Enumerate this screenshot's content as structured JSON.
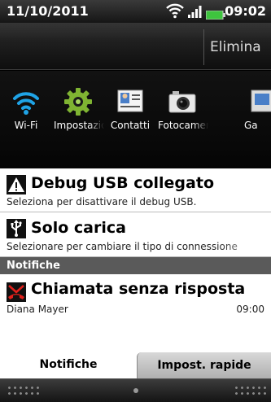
{
  "statusbar": {
    "date": "11/10/2011",
    "time": "09:02",
    "icons": [
      "wifi-signal-icon",
      "cell-signal-icon",
      "battery-icon"
    ]
  },
  "actionbar": {
    "clear_label": "Elimina"
  },
  "quick_toggles": [
    {
      "label": "Wi-Fi",
      "icon": "wifi-icon"
    },
    {
      "label": "Impostazioni",
      "icon": "settings-gear-icon"
    },
    {
      "label": "Contatti",
      "icon": "contacts-icon"
    },
    {
      "label": "Fotocamera",
      "icon": "camera-icon"
    },
    {
      "label": "Ga",
      "icon": "gallery-icon"
    }
  ],
  "ongoing": [
    {
      "title": "Debug USB collegato",
      "subtitle": "Seleziona per disattivare il debug USB.",
      "icon": "warning-icon"
    },
    {
      "title": "Solo carica",
      "subtitle": "Selezionare per cambiare il tipo di connessione",
      "icon": "usb-icon"
    }
  ],
  "notifications_header": "Notifiche",
  "notifications": [
    {
      "title": "Chiamata senza risposta",
      "caller": "Diana Mayer",
      "time": "09:00",
      "icon": "missed-call-icon"
    }
  ],
  "tabs": [
    {
      "label": "Notifiche",
      "selected": true
    },
    {
      "label": "Impost. rapide",
      "selected": false
    }
  ],
  "colors": {
    "missed_call": "#e0201b",
    "wifi_blue": "#1fa3e6",
    "gear_green": "#7fb432"
  }
}
